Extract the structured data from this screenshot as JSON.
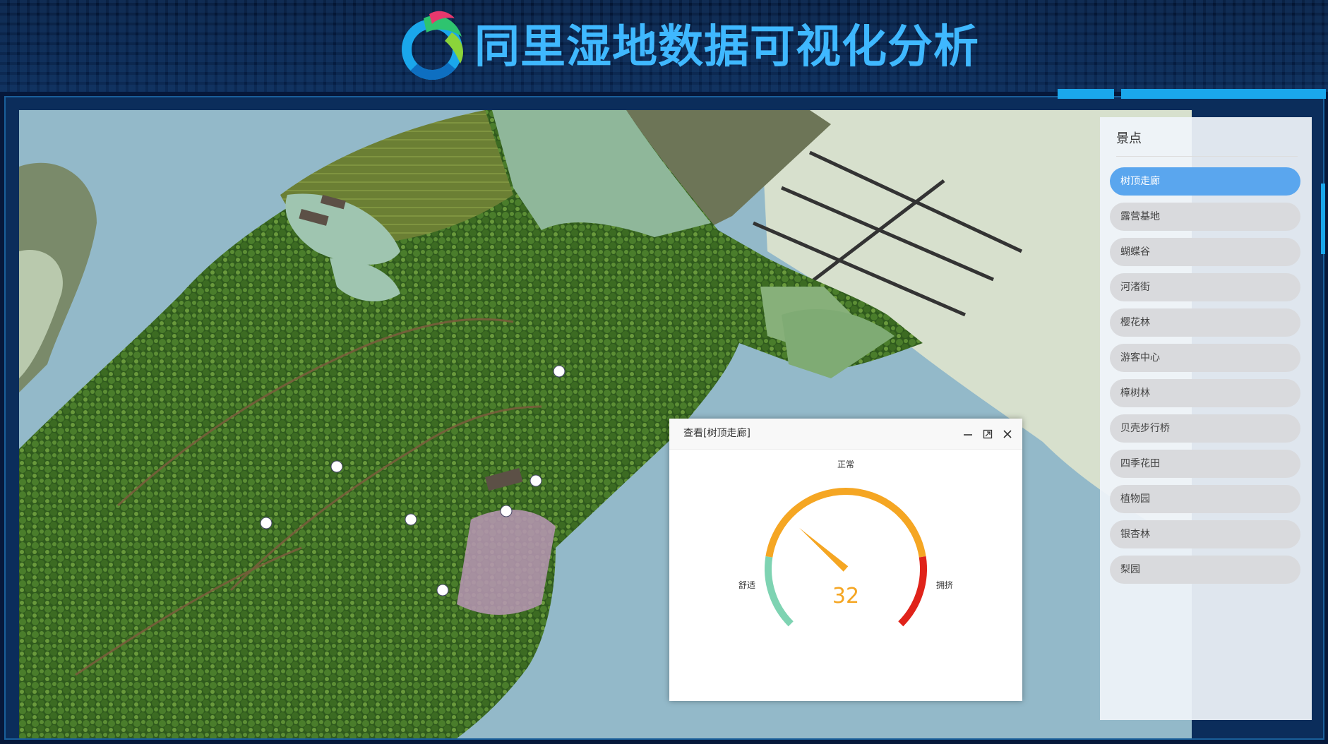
{
  "header": {
    "title": "同里湿地数据可视化分析"
  },
  "panel": {
    "title": "景点",
    "items": [
      {
        "label": "树顶走廊",
        "active": true
      },
      {
        "label": "露营基地"
      },
      {
        "label": "蝴蝶谷"
      },
      {
        "label": "河渚街"
      },
      {
        "label": "樱花林"
      },
      {
        "label": "游客中心"
      },
      {
        "label": "樟树林"
      },
      {
        "label": "贝壳步行桥"
      },
      {
        "label": "四季花田"
      },
      {
        "label": "植物园"
      },
      {
        "label": "银杏林"
      },
      {
        "label": "梨园"
      }
    ]
  },
  "modal": {
    "title": "查看[树顶走廊]",
    "gauge": {
      "value": "32",
      "value_num": 32,
      "max": 100,
      "label_left": "舒适",
      "label_top": "正常",
      "label_right": "拥挤",
      "colors": {
        "low": "#7ed3b2",
        "mid": "#f5a623",
        "high": "#e0231a",
        "pointer": "#f5a623"
      }
    }
  }
}
